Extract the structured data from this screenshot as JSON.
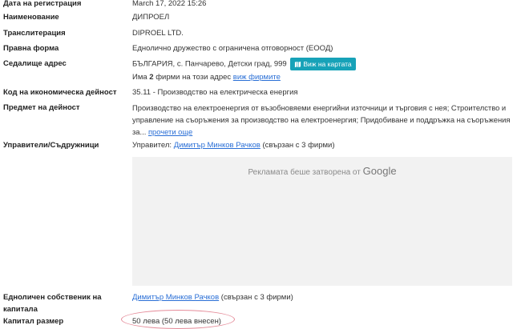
{
  "fields": {
    "registration_date": {
      "label": "Дата на регистрация",
      "value": "March 17, 2022 15:26"
    },
    "name": {
      "label": "Наименование",
      "value": "ДИПРОЕЛ"
    },
    "transliteration": {
      "label": "Транслитерация",
      "value": "DIPROEL LTD."
    },
    "legal_form": {
      "label": "Правна форма",
      "value": "Еднолично дружество с ограничена отговорност (ЕООД)"
    },
    "address": {
      "label": "Седалище адрес",
      "value": "БЪЛГАРИЯ, с. Панчарево, Детски град, 999",
      "map_button": "Виж на картата",
      "firms_prefix": "Има ",
      "firms_count": "2",
      "firms_suffix": " фирми на този адрес ",
      "firms_link": "виж фирмите"
    },
    "activity_code": {
      "label": "Код на икономическа дейност",
      "value": "35.11 - Производство на електрическа енергия"
    },
    "activity": {
      "label": "Предмет на дейност",
      "line1": "Производство на електроенергия от възобновяеми енергийни източници и търговия с нея; Строителство и",
      "line2": "управление на съоръжения за производство на електроенергия; Придобиване и поддръжка на съоръжения",
      "line3": "за...",
      "read_more": "прочети още"
    },
    "managers": {
      "label": "Управители/Съдружници",
      "prefix": "Управител: ",
      "link": "Димитър Минков Рачков",
      "suffix": " (свързан с 3 фирми)"
    },
    "ad": {
      "text": "Рекламата беше затворена от",
      "brand": "Google"
    },
    "sole_owner": {
      "label_line1": "Едноличен собственик на",
      "label_line2": "капитала",
      "link": "Димитър Минков Рачков",
      "suffix": " (свързан с 3 фирми)"
    },
    "capital": {
      "label": "Капитал размер",
      "value": "50 лева (50 лева внесен)"
    }
  }
}
